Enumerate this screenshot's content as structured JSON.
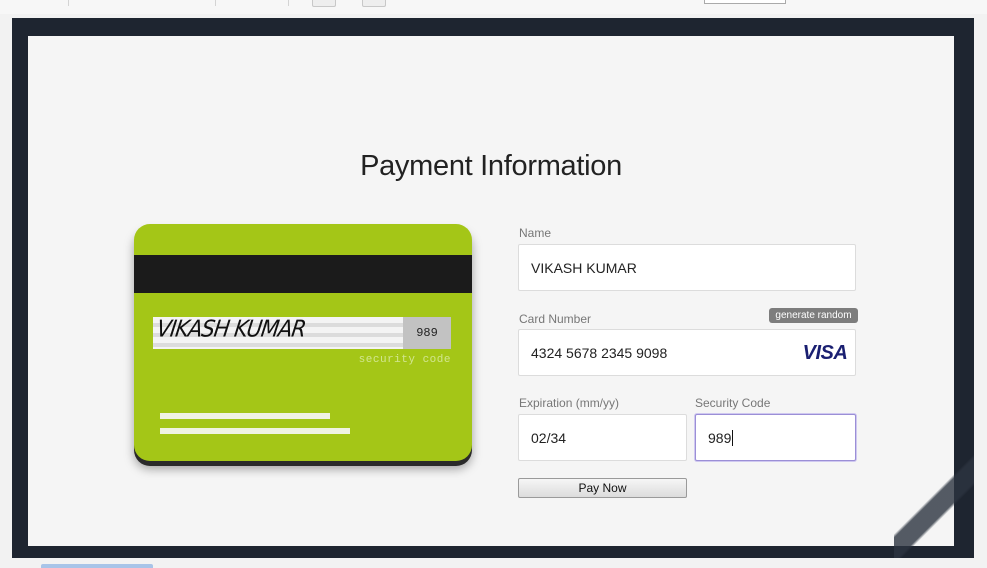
{
  "page": {
    "title": "Payment Information"
  },
  "card": {
    "signature": "VIKASH KUMAR",
    "cvv": "989",
    "security_caption": "security code",
    "color": "#a4c617"
  },
  "form": {
    "name_label": "Name",
    "name_value": "VIKASH KUMAR",
    "card_number_label": "Card Number",
    "card_number_value": "4324 5678 2345 9098",
    "generate_label": "generate random",
    "card_brand": "VISA",
    "expiration_label": "Expiration (mm/yy)",
    "expiration_value": "02/34",
    "security_label": "Security Code",
    "security_value": "989",
    "pay_button": "Pay Now"
  }
}
